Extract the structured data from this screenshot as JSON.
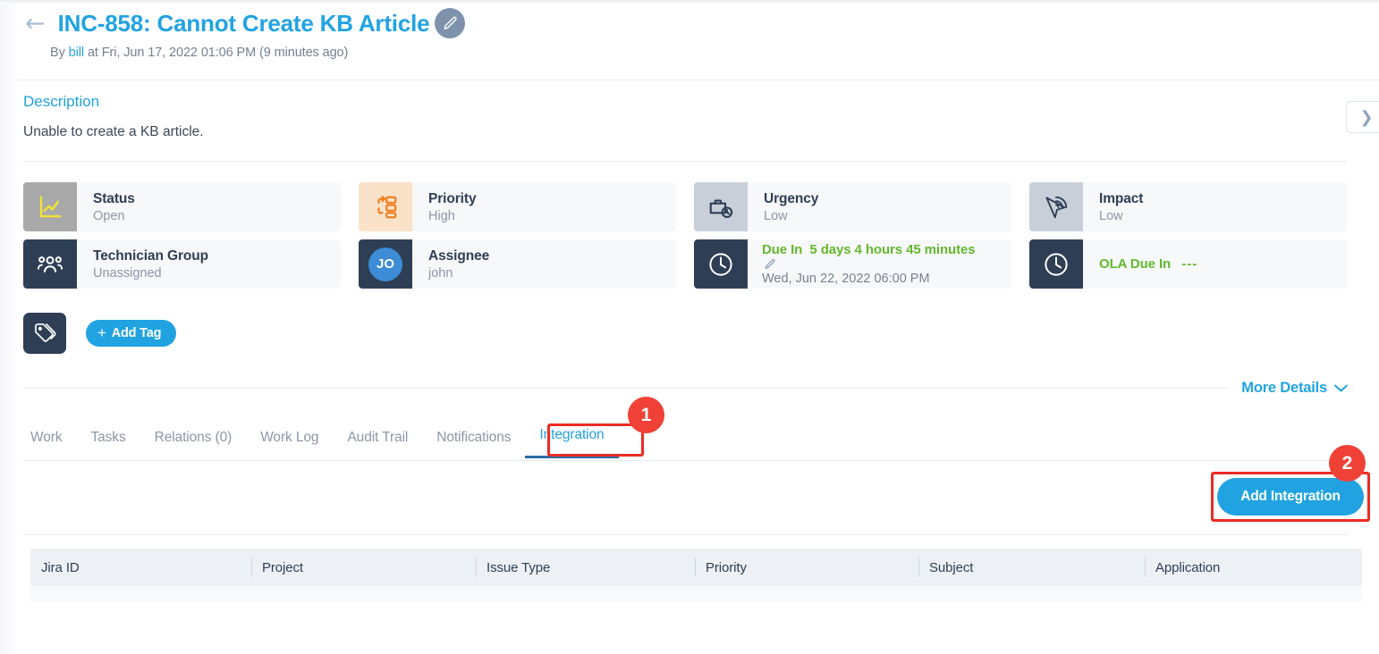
{
  "header": {
    "back_icon": "arrow-left-icon",
    "title": "INC-858: Cannot Create KB Article",
    "edit_icon": "pencil-icon",
    "byline_prefix": "By",
    "author": "bill",
    "byline_suffix": "at Fri, Jun 17, 2022 01:06 PM (9 minutes ago)"
  },
  "description": {
    "heading": "Description",
    "body": "Unable to create a KB article.",
    "next_icon": "chevron-right-icon"
  },
  "cards": [
    {
      "label": "Status",
      "value": "Open",
      "icon": "chart-line-icon",
      "icon_style": "gray"
    },
    {
      "label": "Priority",
      "value": "High",
      "icon": "priority-flow-icon",
      "icon_style": "peach"
    },
    {
      "label": "Urgency",
      "value": "Low",
      "icon": "briefcase-clock-icon",
      "icon_style": "light-gray"
    },
    {
      "label": "Impact",
      "value": "Low",
      "icon": "fingerprint-cursor-icon",
      "icon_style": "light-gray"
    },
    {
      "label": "Technician Group",
      "value": "Unassigned",
      "icon": "users-group-icon",
      "icon_style": "navy"
    },
    {
      "label": "Assignee",
      "value": "john",
      "icon": "avatar-initials",
      "icon_style": "navy",
      "avatar_initials": "JO"
    }
  ],
  "due": {
    "icon": "clock-icon",
    "label": "Due In",
    "value": "5 days 4 hours 45 minutes",
    "edit_icon": "pencil-icon",
    "date": "Wed, Jun 22, 2022 06:00 PM"
  },
  "ola": {
    "icon": "clock-icon",
    "label": "OLA Due In",
    "value": "---"
  },
  "tags": {
    "icon": "tag-icon",
    "add_label": "Add Tag",
    "plus": "+"
  },
  "more_details": {
    "label": "More Details",
    "chevron_icon": "chevron-down-icon"
  },
  "tabs": [
    {
      "label": "Work",
      "active": false
    },
    {
      "label": "Tasks",
      "active": false
    },
    {
      "label": "Relations (0)",
      "active": false
    },
    {
      "label": "Work Log",
      "active": false
    },
    {
      "label": "Audit Trail",
      "active": false
    },
    {
      "label": "Notifications",
      "active": false
    },
    {
      "label": "Integration",
      "active": true
    }
  ],
  "toolbar": {
    "add_integration_label": "Add Integration"
  },
  "table": {
    "columns": [
      "Jira ID",
      "Project",
      "Issue Type",
      "Priority",
      "Subject",
      "Application"
    ],
    "rows": []
  },
  "annotations": [
    {
      "badge": "1",
      "target": "integration-tab"
    },
    {
      "badge": "2",
      "target": "add-integration-button"
    }
  ],
  "colors": {
    "accent_blue": "#21a3e1",
    "navy": "#2e3e55",
    "green": "#63b82e",
    "annotation_red": "#ef4136",
    "muted": "#8a97a6"
  }
}
